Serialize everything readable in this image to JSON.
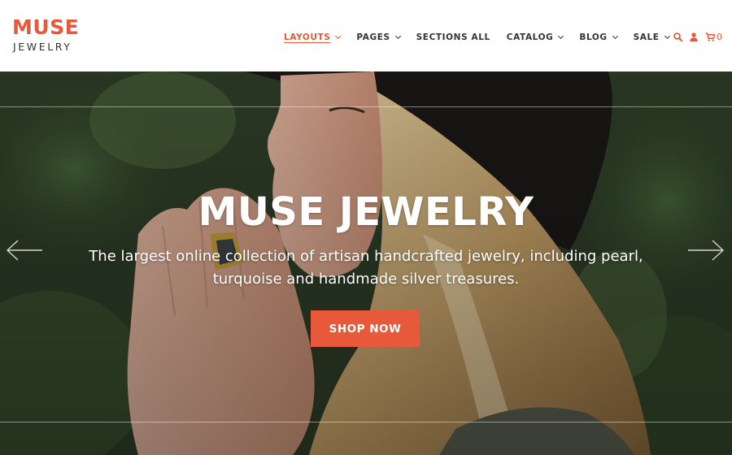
{
  "brand": {
    "name": "MUSE",
    "tagline": "JEWELRY"
  },
  "nav": {
    "items": [
      {
        "label": "LAYOUTS",
        "dropdown": true,
        "active": true
      },
      {
        "label": "PAGES",
        "dropdown": true
      },
      {
        "label": "SECTIONS ALL",
        "dropdown": false
      },
      {
        "label": "CATALOG",
        "dropdown": true
      },
      {
        "label": "BLOG",
        "dropdown": true
      },
      {
        "label": "SALE",
        "dropdown": true
      }
    ]
  },
  "header_icons": {
    "search": "search-icon",
    "account": "user-icon",
    "cart": "cart-icon",
    "cart_count": "0"
  },
  "hero": {
    "title": "MUSE JEWELRY",
    "subtitle": "The largest online collection of artisan handcrafted jewelry, including pearl, turquoise and handmade silver treasures.",
    "cta": "SHOP NOW",
    "prev_icon": "arrow-left-icon",
    "next_icon": "arrow-right-icon"
  },
  "colors": {
    "accent": "#e8583a",
    "text": "#333333",
    "white": "#ffffff"
  }
}
